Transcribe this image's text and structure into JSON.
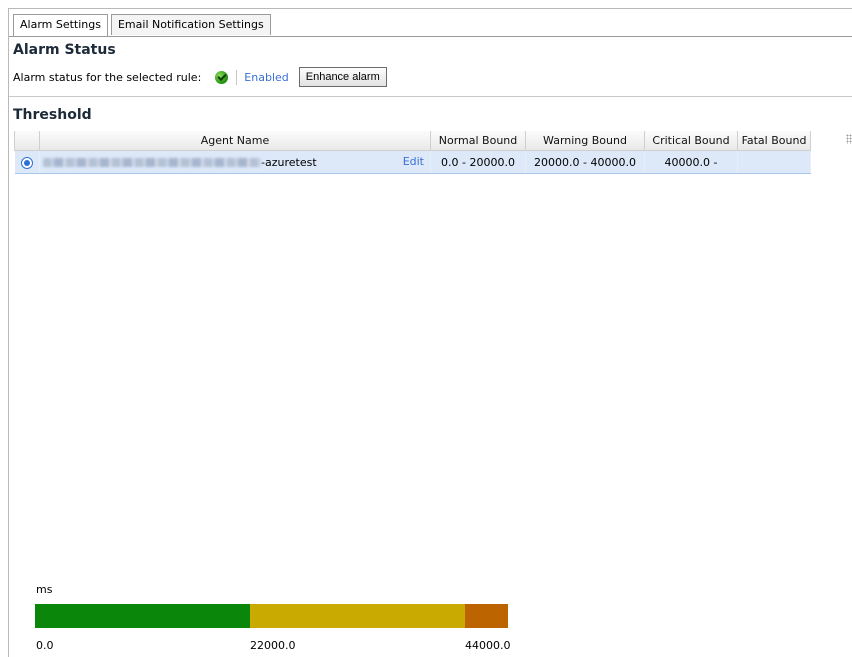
{
  "tabs": [
    {
      "label": "Alarm Settings",
      "active": true
    },
    {
      "label": "Email Notification Settings",
      "active": false
    }
  ],
  "alarm_status": {
    "title": "Alarm Status",
    "label": "Alarm status for the selected rule:",
    "status_text": "Enabled",
    "button_label": "Enhance alarm"
  },
  "threshold": {
    "title": "Threshold",
    "columns": [
      "Agent Name",
      "Normal Bound",
      "Warning Bound",
      "Critical Bound",
      "Fatal Bound"
    ],
    "rows": [
      {
        "agent_suffix": "-azuretest",
        "edit_label": "Edit",
        "normal": "0.0 - 20000.0",
        "warning": "20000.0 - 40000.0",
        "critical": "40000.0 -",
        "fatal": ""
      }
    ]
  },
  "scale": {
    "unit": "ms",
    "ticks": [
      "0.0",
      "22000.0",
      "44000.0"
    ],
    "max": 44000,
    "segments": [
      {
        "from": 0,
        "to": 20000,
        "color": "#0a870a"
      },
      {
        "from": 20000,
        "to": 40000,
        "color": "#c8aa00"
      },
      {
        "from": 40000,
        "to": 44000,
        "color": "#bc6500"
      }
    ]
  }
}
